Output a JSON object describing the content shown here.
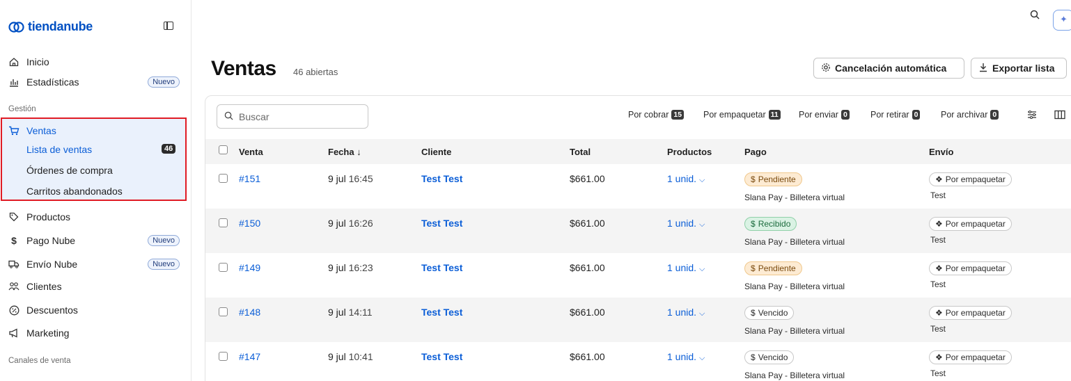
{
  "brand": {
    "name": "tiendanube",
    "color": "#0050c3"
  },
  "sidebar": {
    "items_top": [
      {
        "label": "Inicio",
        "icon": "home-icon"
      },
      {
        "label": "Estadísticas",
        "icon": "chart-icon",
        "badge": "Nuevo"
      }
    ],
    "gestion_label": "Gestión",
    "ventas": {
      "label": "Ventas",
      "icon": "cart-icon",
      "sub": [
        "Lista de ventas",
        "Órdenes de compra",
        "Carritos abandonados"
      ],
      "count": "46"
    },
    "items_mid": [
      {
        "label": "Productos",
        "icon": "tag-icon"
      },
      {
        "label": "Pago Nube",
        "icon": "dollar-icon",
        "badge": "Nuevo"
      },
      {
        "label": "Envío Nube",
        "icon": "truck-icon",
        "badge": "Nuevo"
      },
      {
        "label": "Clientes",
        "icon": "users-icon"
      },
      {
        "label": "Descuentos",
        "icon": "percent-icon"
      },
      {
        "label": "Marketing",
        "icon": "megaphone-icon"
      }
    ],
    "canales_label": "Canales de venta"
  },
  "header": {
    "title": "Ventas",
    "subtitle": "46 abiertas",
    "btn_cancel": "Cancelación automática",
    "btn_export": "Exportar lista"
  },
  "toolbar": {
    "search_placeholder": "Buscar",
    "filters": [
      {
        "label": "Por cobrar",
        "count": "15"
      },
      {
        "label": "Por empaquetar",
        "count": "11"
      },
      {
        "label": "Por enviar",
        "count": "0"
      },
      {
        "label": "Por retirar",
        "count": "0"
      },
      {
        "label": "Por archivar",
        "count": "0"
      }
    ]
  },
  "table": {
    "columns": [
      "Venta",
      "Fecha ↓",
      "Cliente",
      "Total",
      "Productos",
      "Pago",
      "Envío"
    ],
    "rows": [
      {
        "id": "#151",
        "date": "9 jul",
        "time": "16:45",
        "client": "Test Test",
        "total": "$661.00",
        "products": "1 unid.",
        "pay_status": "Pendiente",
        "pay_method": "Slana Pay - Billetera virtual",
        "ship_status": "Por empaquetar",
        "ship_detail": "Test"
      },
      {
        "id": "#150",
        "date": "9 jul",
        "time": "16:26",
        "client": "Test Test",
        "total": "$661.00",
        "products": "1 unid.",
        "pay_status": "Recibido",
        "pay_method": "Slana Pay - Billetera virtual",
        "ship_status": "Por empaquetar",
        "ship_detail": "Test"
      },
      {
        "id": "#149",
        "date": "9 jul",
        "time": "16:23",
        "client": "Test Test",
        "total": "$661.00",
        "products": "1 unid.",
        "pay_status": "Pendiente",
        "pay_method": "Slana Pay - Billetera virtual",
        "ship_status": "Por empaquetar",
        "ship_detail": "Test"
      },
      {
        "id": "#148",
        "date": "9 jul",
        "time": "14:11",
        "client": "Test Test",
        "total": "$661.00",
        "products": "1 unid.",
        "pay_status": "Vencido",
        "pay_method": "Slana Pay - Billetera virtual",
        "ship_status": "Por empaquetar",
        "ship_detail": "Test"
      },
      {
        "id": "#147",
        "date": "9 jul",
        "time": "10:41",
        "client": "Test Test",
        "total": "$661.00",
        "products": "1 unid.",
        "pay_status": "Vencido",
        "pay_method": "Slana Pay - Billetera virtual",
        "ship_status": "Por empaquetar",
        "ship_detail": "Test"
      }
    ]
  }
}
